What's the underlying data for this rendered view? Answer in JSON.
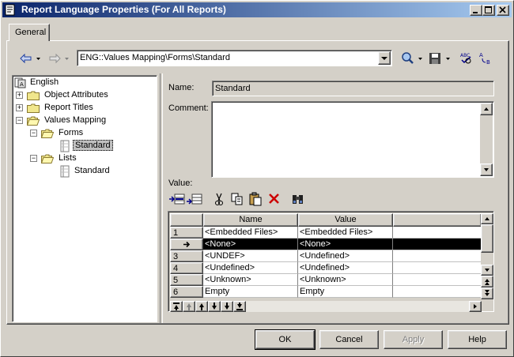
{
  "window": {
    "title": "Report Language Properties (For All Reports)",
    "minimize": "_",
    "maximize": "□",
    "close": "✕"
  },
  "tabs": [
    {
      "label": "General"
    }
  ],
  "nav": {
    "path": "ENG::Values Mapping\\Forms\\Standard"
  },
  "tree": {
    "root": "English",
    "items": [
      {
        "label": "Object Attributes"
      },
      {
        "label": "Report Titles"
      },
      {
        "label": "Values Mapping"
      },
      {
        "label": "Forms"
      },
      {
        "label": "Standard"
      },
      {
        "label": "Lists"
      },
      {
        "label": "Standard"
      }
    ]
  },
  "form": {
    "name_label": "Name:",
    "name_value": "Standard",
    "comment_label": "Comment:",
    "value_label": "Value:"
  },
  "grid": {
    "columns": [
      "Name",
      "Value"
    ],
    "rows": [
      {
        "num": "1",
        "name": "<Embedded Files>",
        "value": "<Embedded Files>"
      },
      {
        "num": "→",
        "name": "<None>",
        "value": "<None>"
      },
      {
        "num": "3",
        "name": "<UNDEF>",
        "value": "<Undefined>"
      },
      {
        "num": "4",
        "name": "<Undefined>",
        "value": "<Undefined>"
      },
      {
        "num": "5",
        "name": "<Unknown>",
        "value": "<Unknown>"
      },
      {
        "num": "6",
        "name": "Empty",
        "value": "Empty"
      }
    ]
  },
  "buttons": {
    "ok": "OK",
    "cancel": "Cancel",
    "apply": "Apply",
    "help": "Help"
  },
  "colors": {
    "title_start": "#0a246a",
    "title_end": "#a6caf0",
    "face": "#d4d0c8",
    "selection": "#000000"
  }
}
